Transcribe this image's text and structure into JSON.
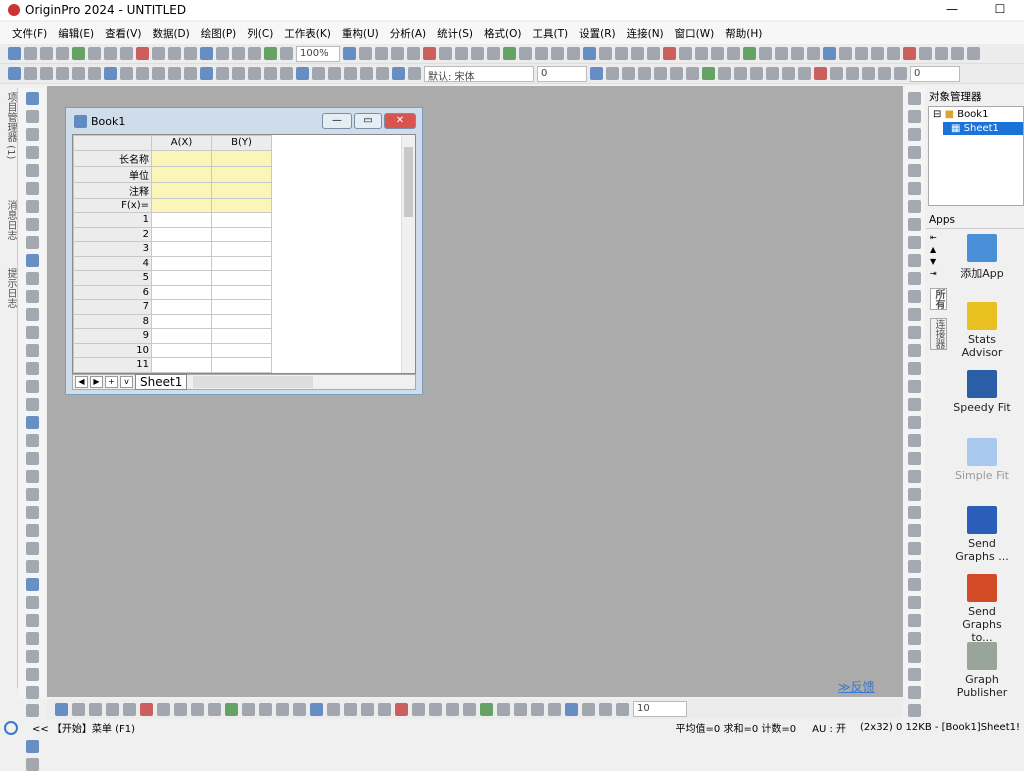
{
  "window": {
    "title": "OriginPro 2024 - UNTITLED",
    "minimize": "—",
    "maximize": "☐"
  },
  "menu": [
    "文件(F)",
    "编辑(E)",
    "查看(V)",
    "数据(D)",
    "绘图(P)",
    "列(C)",
    "工作表(K)",
    "重构(U)",
    "分析(A)",
    "统计(S)",
    "格式(O)",
    "工具(T)",
    "设置(R)",
    "连接(N)",
    "窗口(W)",
    "帮助(H)"
  ],
  "toolbar": {
    "zoom": "100%",
    "font": "默认: 宋体",
    "font_size": "0",
    "line_width": "0",
    "bottom_size": "10"
  },
  "left_tabs": [
    "项目管理器 (1)",
    "消息日志",
    "提示日志"
  ],
  "book": {
    "title": "Book1",
    "columns": [
      "A(X)",
      "B(Y)"
    ],
    "meta_rows": [
      "长名称",
      "单位",
      "注释",
      "F(x)="
    ],
    "rows": [
      "1",
      "2",
      "3",
      "4",
      "5",
      "6",
      "7",
      "8",
      "9",
      "10",
      "11"
    ],
    "sheet_tab": "Sheet1"
  },
  "object_manager": {
    "title": "对象管理器",
    "book": "Book1",
    "sheet": "Sheet1"
  },
  "apps": {
    "title": "Apps",
    "tabs": [
      "所有",
      "连接器"
    ],
    "items": [
      "添加App",
      "Stats Advisor",
      "Speedy Fit",
      "Simple Fit",
      "Send Graphs ...",
      "Send Graphs to...",
      "Graph Publisher"
    ],
    "colors": [
      "#4a90d9",
      "#e8c020",
      "#2a5fa8",
      "#a9c8ee",
      "#2b5eb8",
      "#d24a26",
      "#9aa59a"
    ]
  },
  "feedback": "≫反馈",
  "status": {
    "hint": "<<  【开始】菜单 (F1)",
    "stats": "平均值=0 求和=0 计数=0",
    "au": "AU : 开",
    "info": "(2x32) 0   12KB - [Book1]Sheet1!"
  }
}
